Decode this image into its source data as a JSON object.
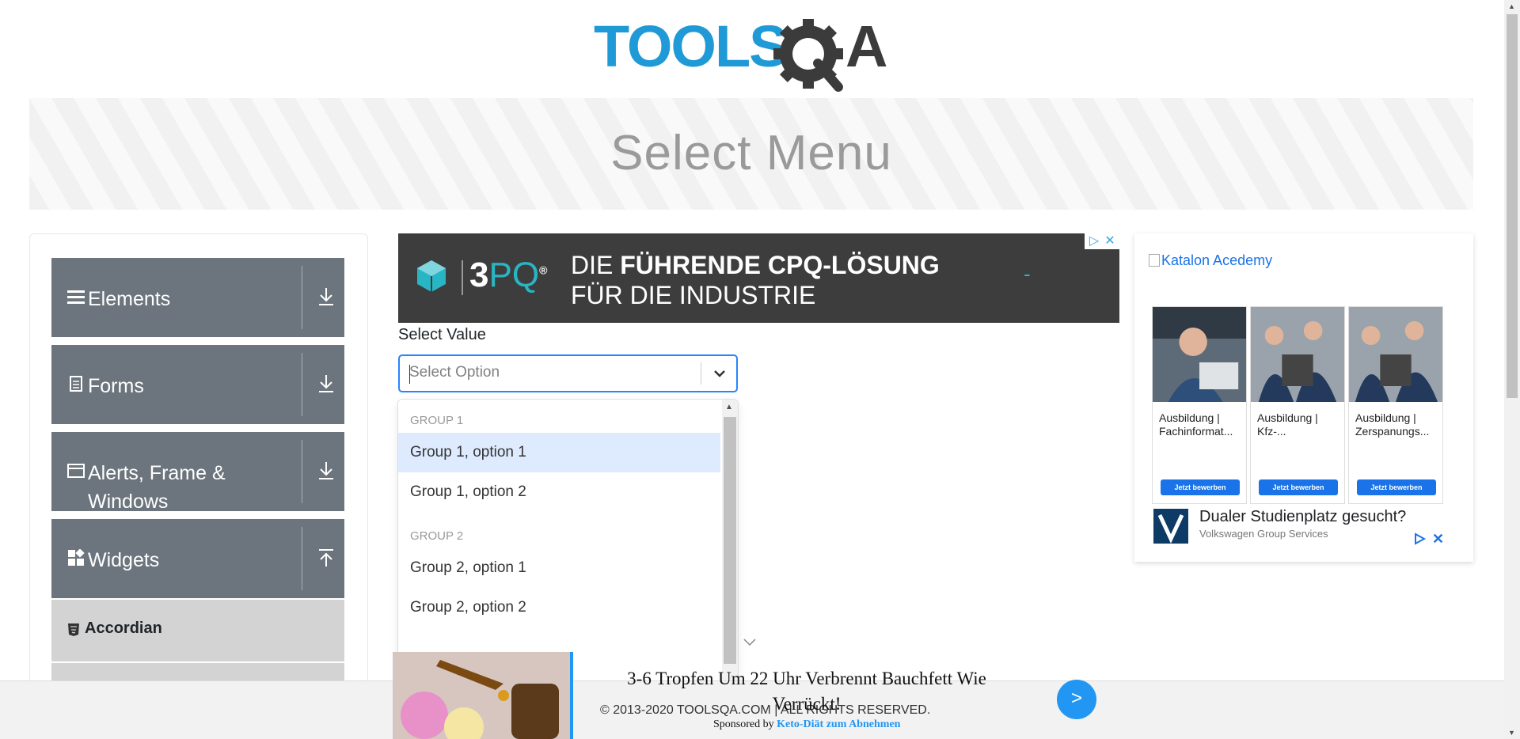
{
  "header": {
    "logo_text": "TOOLSQA"
  },
  "banner": {
    "title": "Select Menu"
  },
  "sidebar": {
    "groups": [
      {
        "label": "Elements",
        "icon": "hamburger-icon",
        "arrow": "download-icon"
      },
      {
        "label": "Forms",
        "icon": "document-icon",
        "arrow": "download-icon"
      },
      {
        "label": "Alerts, Frame & Windows",
        "icon": "browser-window-icon",
        "arrow": "download-icon"
      },
      {
        "label": "Widgets",
        "icon": "widgets-icon",
        "arrow": "upload-icon"
      }
    ],
    "sub_items": [
      {
        "label": "Accordian",
        "icon": "html5-icon"
      }
    ]
  },
  "ad_top": {
    "brand": "3",
    "brand_accent": "PQ",
    "line1_prefix": "DIE ",
    "line1_bold": "FÜHRENDE CPQ-LÖSUNG",
    "line2": "FÜR DIE INDUSTRIE",
    "dash": "-",
    "accent_color": "#29b6c4"
  },
  "select": {
    "label": "Select Value",
    "placeholder": "Select Option",
    "groups": [
      {
        "title": "Group 1",
        "options": [
          "Group 1, option 1",
          "Group 1, option 2"
        ]
      },
      {
        "title": "Group 2",
        "options": [
          "Group 2, option 1",
          "Group 2, option 2"
        ]
      }
    ],
    "focused_option": "Group 1, option 1"
  },
  "ad_right": {
    "broken_image_alt": "Katalon Acedemy",
    "cards": [
      {
        "text": "Ausbildung | Fachinformat...",
        "button": "Jetzt bewerben"
      },
      {
        "text": "Ausbildung | Kfz-...",
        "button": "Jetzt bewerben"
      },
      {
        "text": "Ausbildung | Zerspanungs...",
        "button": "Jetzt bewerben"
      }
    ],
    "headline": "Dualer Studienplatz gesucht?",
    "advertiser": "Volkswagen Group Services"
  },
  "footer": {
    "copyright": "© 2013-2020 TOOLSQA.COM | ALL RIGHTS RESERVED."
  },
  "ad_bottom": {
    "headline": "3-6 Tropfen Um 22 Uhr Verbrennt Bauchfett Wie Verrückt!",
    "sponsored_prefix": "Sponsored by ",
    "sponsor": "Keto-Diät zum Abnehmen",
    "go_label": ">"
  }
}
